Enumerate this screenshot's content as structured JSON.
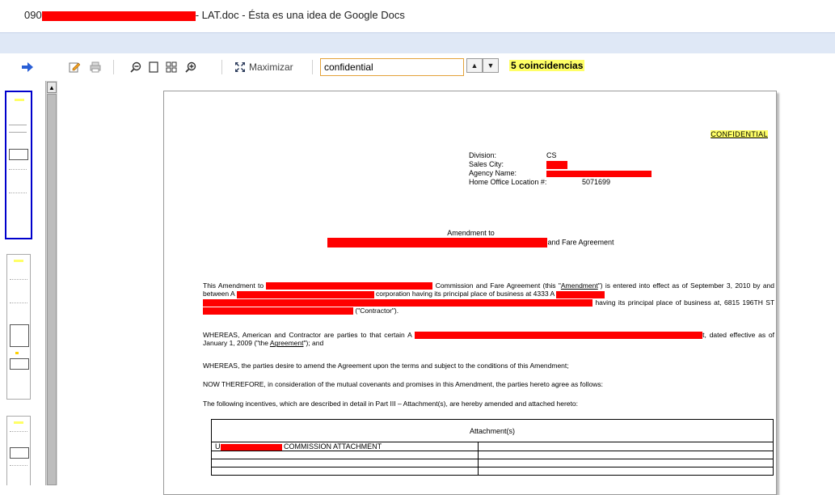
{
  "window": {
    "title_prefix": "090",
    "title_suffix": "- LAT.doc - Ésta es una idea de Google Docs"
  },
  "toolbar": {
    "maximize_label": "Maximizar",
    "search_value": "confidential",
    "matches_label": "5 coincidencias"
  },
  "icons": {
    "forward": "arrow-right-icon",
    "edit": "pencil-icon",
    "print": "printer-icon",
    "zoom_out": "zoom-out-icon",
    "single_page": "single-page-icon",
    "grid": "grid-view-icon",
    "zoom_in": "zoom-in-icon",
    "maximize": "maximize-icon",
    "prev": "chevron-up-icon",
    "next": "chevron-down-icon"
  },
  "document": {
    "confidential": "CONFIDENTIAL",
    "division_label": "Division:",
    "division_value": "CS",
    "sales_city_label": "Sales City:",
    "agency_label": "Agency Name:",
    "home_office_label": "Home Office Location #:",
    "home_office_value": "5071699",
    "amendment_to": "Amendment to",
    "fare_agreement": "and Fare Agreement",
    "p1_a": "This Amendment to",
    "p1_b": "Commission and Fare Agreement (this \"",
    "p1_amendment": "Amendment",
    "p1_c": "\") is entered into effect as of September 3, 2010 by and between A",
    "p1_d": "corporation having its principal place of business at 4333 A",
    "p1_e": "having its principal place of business at, 6815 196TH ST",
    "p1_f": "(\"Contractor\").",
    "p2_a": "WHEREAS, American and Contractor are parties to that certain A",
    "p2_b": "t, dated effective as of January 1, 2009 (\"the ",
    "p2_agreement": "Agreement",
    "p2_c": "\"); and",
    "p3": "WHEREAS, the parties desire to amend the Agreement upon the terms and subject to the conditions of this Amendment;",
    "p4": "NOW THEREFORE, in consideration of the mutual covenants and promises in this Amendment, the parties hereto agree as follows:",
    "p5": "The following incentives, which are described in detail in Part III – Attachment(s), are hereby amended and attached hereto:",
    "table_header": "Attachment(s)",
    "row1_prefix": "U",
    "row1_label": "COMMISSION ATTACHMENT"
  },
  "colors": {
    "redaction": "#ff0000",
    "highlight": "#ffff66",
    "band": "#dfe8f6",
    "active_thumb_border": "#0000cc"
  }
}
